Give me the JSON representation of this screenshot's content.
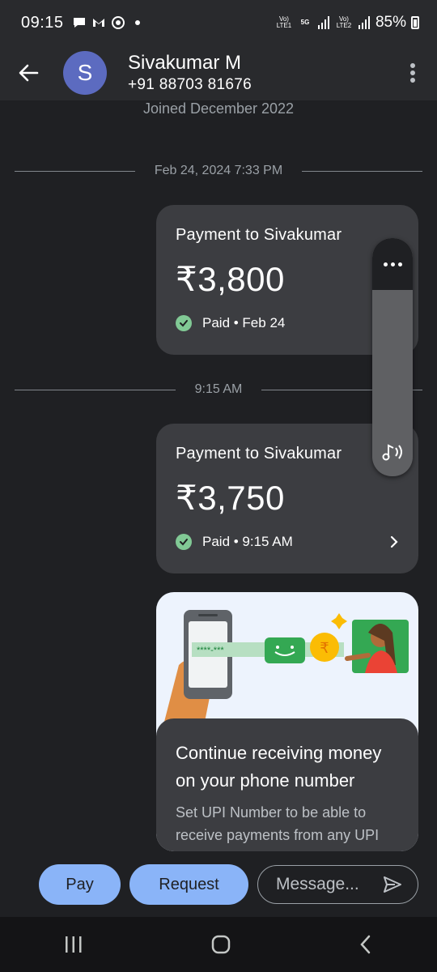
{
  "status_bar": {
    "time": "09:15",
    "battery": "85%",
    "network1": "Vo) LTE1",
    "network_type": "5G",
    "network2": "Vo) LTE2"
  },
  "header": {
    "avatar_letter": "S",
    "name": "Sivakumar M",
    "phone": "+91 88703 81676"
  },
  "conversation": {
    "joined": "Joined December 2022",
    "divider1": "Feb 24, 2024 7:33 PM",
    "divider2": "9:15 AM",
    "payments": [
      {
        "title": "Payment to Sivakumar",
        "amount": "₹3,800",
        "status": "Paid • Feb 24"
      },
      {
        "title": "Payment to Sivakumar",
        "amount": "₹3,750",
        "status": "Paid • 9:15 AM"
      }
    ],
    "promo": {
      "phone_mask": "****-***",
      "headline": "Continue receiving money on your phone number",
      "subtext": "Set UPI Number to be able to receive payments from any UPI app"
    }
  },
  "composer": {
    "pay_label": "Pay",
    "request_label": "Request",
    "message_placeholder": "Message..."
  },
  "colors": {
    "background": "#1f2023",
    "card": "#3c3d41",
    "accent": "#8ab4f8",
    "success": "#81c995"
  }
}
